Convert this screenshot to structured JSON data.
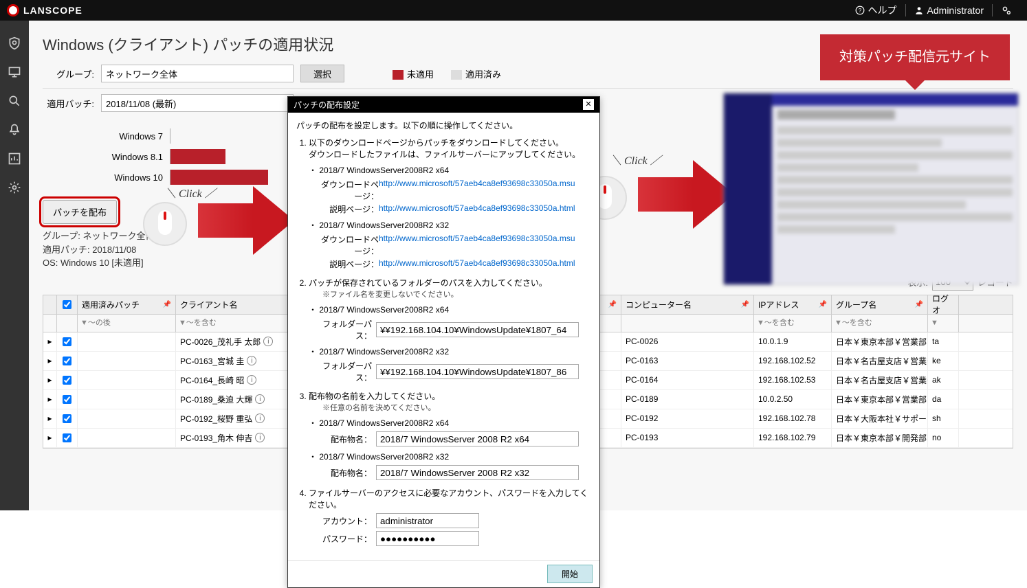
{
  "topbar": {
    "brand": "LANSCOPE",
    "help": "ヘルプ",
    "user": "Administrator"
  },
  "page_title": "Windows (クライアント) パッチの適用状況",
  "filters": {
    "group_label": "グループ:",
    "group_value": "ネットワーク全体",
    "select_btn": "選択",
    "patch_label": "適用バッチ:",
    "patch_value": "2018/11/08 (最新)"
  },
  "legend": {
    "not_applied": "未適用",
    "applied": "適用済み"
  },
  "chart_data": {
    "type": "bar",
    "title": "",
    "categories": [
      "Windows 7",
      "Windows 8.1",
      "Windows 10"
    ],
    "values": [
      0,
      19,
      34
    ],
    "xlim": [
      0,
      100
    ],
    "color": "#b8202a",
    "ylabel": "",
    "xlabel": ""
  },
  "click_label": "＼ Click ／",
  "dist": {
    "button": "パッチを配布",
    "line1": "グループ: ネットワーク全体",
    "line2": "適用パッチ: 2018/11/08",
    "line3": "OS: Windows 10 [未適用]"
  },
  "records": {
    "label1": "表示:",
    "value": "100",
    "label2": "レコード"
  },
  "grid": {
    "headers": {
      "patch": "適用済みパッチ",
      "client": "クライアント名",
      "computer": "コンピューター名",
      "ip": "IPアドレス",
      "group": "グループ名",
      "log": "ログオ"
    },
    "filter_placeholder_after": "～の後",
    "filter_placeholder_incl": "～を含む",
    "rows": [
      {
        "client": "PC-0026_茂礼手 太郎",
        "comp": "PC-0026",
        "ip": "10.0.1.9",
        "group": "日本￥東京本部￥営業部",
        "log": "ta"
      },
      {
        "client": "PC-0163_宮城 圭",
        "comp": "PC-0163",
        "ip": "192.168.102.52",
        "group": "日本￥名古屋支店￥営業部",
        "log": "ke"
      },
      {
        "client": "PC-0164_長崎 昭",
        "comp": "PC-0164",
        "ip": "192.168.102.53",
        "group": "日本￥名古屋支店￥営業部",
        "log": "ak"
      },
      {
        "client": "PC-0189_桑迫 大輝",
        "comp": "PC-0189",
        "ip": "10.0.2.50",
        "group": "日本￥東京本部￥営業部",
        "log": "da"
      },
      {
        "client": "PC-0192_桜野 重弘",
        "comp": "PC-0192",
        "ip": "192.168.102.78",
        "group": "日本￥大阪本社￥サポート部",
        "log": "sh"
      },
      {
        "client": "PC-0193_角木 伸吉",
        "comp": "PC-0193",
        "ip": "192.168.102.79",
        "group": "日本￥東京本部￥開発部",
        "log": "no"
      }
    ]
  },
  "modal": {
    "title": "パッチの配布設定",
    "intro": "パッチの配布を設定します。以下の順に操作してください。",
    "step1": "以下のダウンロードページからパッチをダウンロードしてください。",
    "step1b": "ダウンロードしたファイルは、ファイルサーバーにアップしてください。",
    "item64": "2018/7 WindowsServer2008R2 x64",
    "item32": "2018/7 WindowsServer2008R2 x32",
    "dl_label": "ダウンロードページ：",
    "desc_label": "説明ページ：",
    "dl_url": "http://www.microsoft/57aeb4ca8ef93698c33050a.msu",
    "desc_url": "http://www.microsoft/57aeb4ca8ef93698c33050a.html",
    "step2": "パッチが保存されているフォルダーのパスを入力してください。",
    "step2_note": "※ファイル名を変更しないでください。",
    "folder_label": "フォルダーパス：",
    "folder64": "¥¥192.168.104.10¥WindowsUpdate¥1807_64",
    "folder86": "¥¥192.168.104.10¥WindowsUpdate¥1807_86",
    "step3": "配布物の名前を入力してください。",
    "step3_note": "※任意の名前を決めてください。",
    "dist_label": "配布物名：",
    "dist64": "2018/7 WindowsServer 2008 R2 x64",
    "dist32": "2018/7 WindowsServer 2008 R2 x32",
    "step4": "ファイルサーバーのアクセスに必要なアカウント、パスワードを入力してください。",
    "acct_label": "アカウント：",
    "acct": "administrator",
    "pw_label": "パスワード：",
    "pw": "●●●●●●●●●●",
    "start": "開始"
  },
  "callout": "対策パッチ配信元サイト"
}
